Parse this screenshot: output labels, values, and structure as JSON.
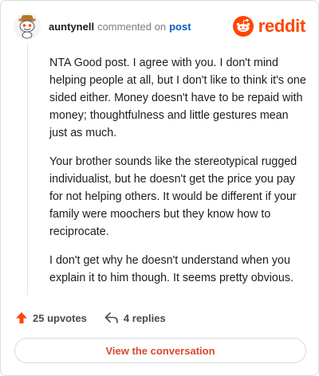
{
  "header": {
    "username": "auntynell",
    "commented_on": "commented on",
    "post_link": "post",
    "brand": "reddit"
  },
  "comment": {
    "paragraphs": [
      "NTA Good post. I agree with you. I don't mind helping people at all, but I don't like to think it's one sided either. Money doesn't have to be repaid with money; thoughtfulness and little gestures mean just as much.",
      "Your brother sounds like the stereotypical rugged individualist, but he doesn't get the price you pay for not helping others. It would be different if your family were moochers but they know how to reciprocate.",
      "I don't get why he doesn't understand when you explain it to him though. It seems pretty obvious."
    ]
  },
  "footer": {
    "upvotes": "25 upvotes",
    "replies": "4 replies"
  },
  "cta": {
    "label": "View the conversation"
  },
  "colors": {
    "brand": "#ff4500",
    "upvote": "#ff4500",
    "link": "#0a5ec4",
    "cta_text": "#d9482b"
  },
  "icons": {
    "avatar": "snoo-avatar",
    "brand": "reddit-logo-icon",
    "upvote": "upvote-arrow-icon",
    "reply": "reply-arrow-icon"
  }
}
